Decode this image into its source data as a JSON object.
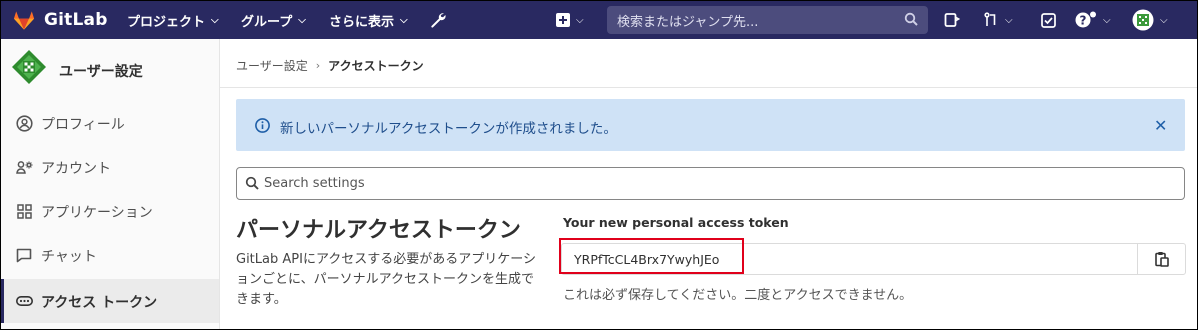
{
  "navbar": {
    "brand": "GitLab",
    "projects_label": "プロジェクト",
    "groups_label": "グループ",
    "more_label": "さらに表示",
    "search_placeholder": "検索またはジャンプ先..."
  },
  "sidebar": {
    "title": "ユーザー設定",
    "items": [
      {
        "label": "プロフィール",
        "icon": "profile-icon"
      },
      {
        "label": "アカウント",
        "icon": "account-icon"
      },
      {
        "label": "アプリケーション",
        "icon": "applications-icon"
      },
      {
        "label": "チャット",
        "icon": "chat-icon"
      },
      {
        "label": "アクセス トークン",
        "icon": "token-icon",
        "active": true
      }
    ]
  },
  "breadcrumb": {
    "parent": "ユーザー設定",
    "current": "アクセストークン"
  },
  "alert": {
    "message": "新しいパーソナルアクセストークンが作成されました。"
  },
  "settings_search": {
    "placeholder": "Search settings"
  },
  "section": {
    "title": "パーソナルアクセストークン",
    "description": "GitLab APIにアクセスする必要があるアプリケーションごとに、パーソナルアクセストークンを生成できます。"
  },
  "token": {
    "label": "Your new personal access token",
    "value": "YRPfTcCL4Brx7YwyhJEo",
    "help": "これは必ず保存してください。二度とアクセスできません。"
  },
  "colors": {
    "navbar_bg": "#292961",
    "alert_bg": "#cfe2f6",
    "highlight": "#e0001b"
  }
}
